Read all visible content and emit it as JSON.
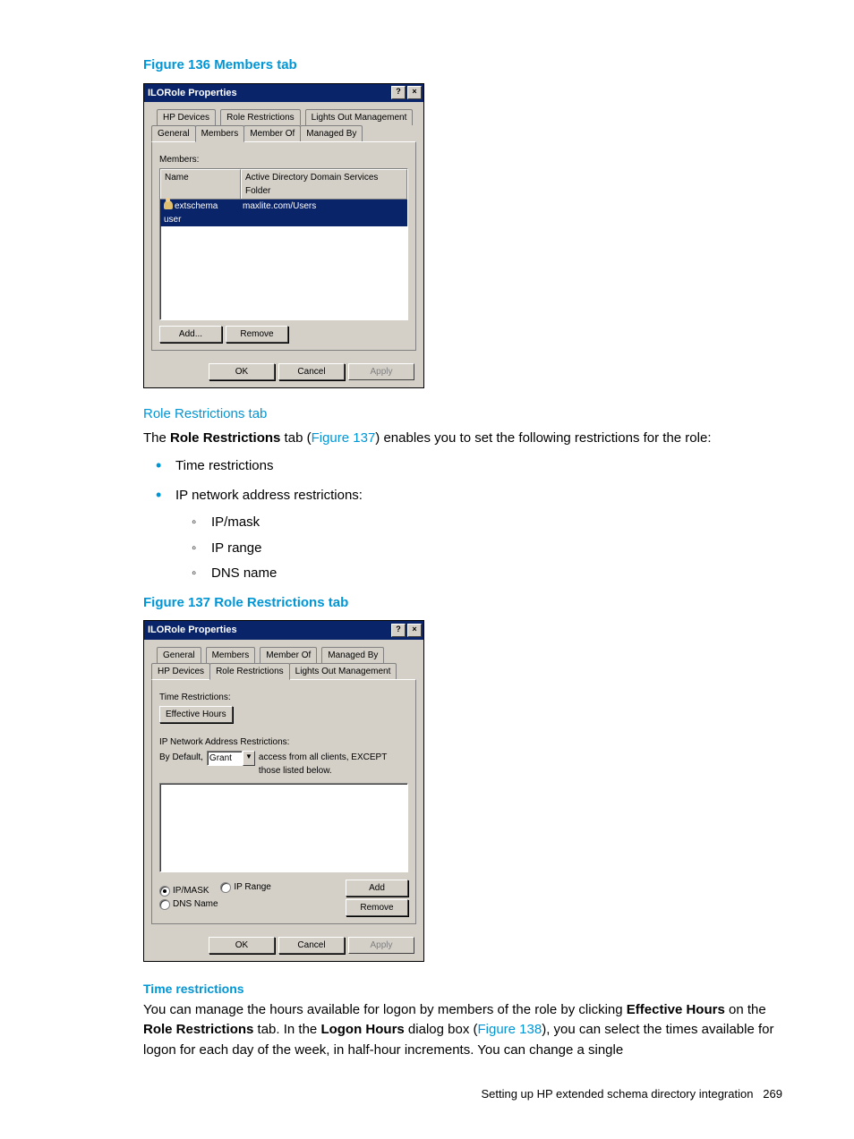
{
  "figure136": {
    "caption": "Figure 136 Members tab",
    "dialog": {
      "title": "ILORole Properties",
      "help_btn": "?",
      "close_btn": "×",
      "tabs_row1": [
        "HP Devices",
        "Role Restrictions",
        "Lights Out Management"
      ],
      "tabs_row2": [
        "General",
        "Members",
        "Member Of",
        "Managed By"
      ],
      "active_tab": "Members",
      "members_label": "Members:",
      "columns": {
        "name": "Name",
        "folder": "Active Directory Domain Services Folder"
      },
      "rows": [
        {
          "name": "extschema user",
          "folder": "maxlite.com/Users"
        }
      ],
      "add_btn": "Add...",
      "remove_btn": "Remove",
      "ok_btn": "OK",
      "cancel_btn": "Cancel",
      "apply_btn": "Apply"
    }
  },
  "section_role_restrictions": {
    "heading": "Role Restrictions tab",
    "para_prefix": "The ",
    "para_bold1": "Role Restrictions",
    "para_mid1": " tab (",
    "para_link": "Figure 137",
    "para_suffix": ") enables you to set the following restrictions for the role:",
    "bullets": [
      "Time restrictions",
      "IP network address restrictions:"
    ],
    "sub_bullets": [
      "IP/mask",
      "IP range",
      "DNS name"
    ]
  },
  "figure137": {
    "caption": "Figure 137 Role Restrictions tab",
    "dialog": {
      "title": "ILORole Properties",
      "help_btn": "?",
      "close_btn": "×",
      "tabs_row1": [
        "General",
        "Members",
        "Member Of",
        "Managed By"
      ],
      "tabs_row2": [
        "HP Devices",
        "Role Restrictions",
        "Lights Out Management"
      ],
      "active_tab": "Role Restrictions",
      "time_label": "Time Restrictions:",
      "effective_hours_btn": "Effective Hours",
      "ip_label": "IP Network Address Restrictions:",
      "bydefault_label": "By Default,",
      "grant_value": "Grant",
      "access_text_l1": "access from all clients, EXCEPT",
      "access_text_l2": "those listed below.",
      "radios": {
        "ipmask": "IP/MASK",
        "iprange": "IP Range",
        "dnsname": "DNS Name"
      },
      "add_btn": "Add",
      "remove_btn": "Remove",
      "ok_btn": "OK",
      "cancel_btn": "Cancel",
      "apply_btn": "Apply"
    }
  },
  "time_restrictions": {
    "heading": "Time restrictions",
    "p_a": "You can manage the hours available for logon by members of the role by clicking ",
    "p_b": "Effective Hours",
    "p_c": " on the ",
    "p_d": "Role Restrictions",
    "p_e": " tab. In the ",
    "p_f": "Logon Hours",
    "p_g": " dialog box (",
    "p_link": "Figure 138",
    "p_h": "), you can select the times available for logon for each day of the week, in half-hour increments. You can change a single"
  },
  "footer": {
    "text": "Setting up HP extended schema directory integration",
    "page": "269"
  }
}
